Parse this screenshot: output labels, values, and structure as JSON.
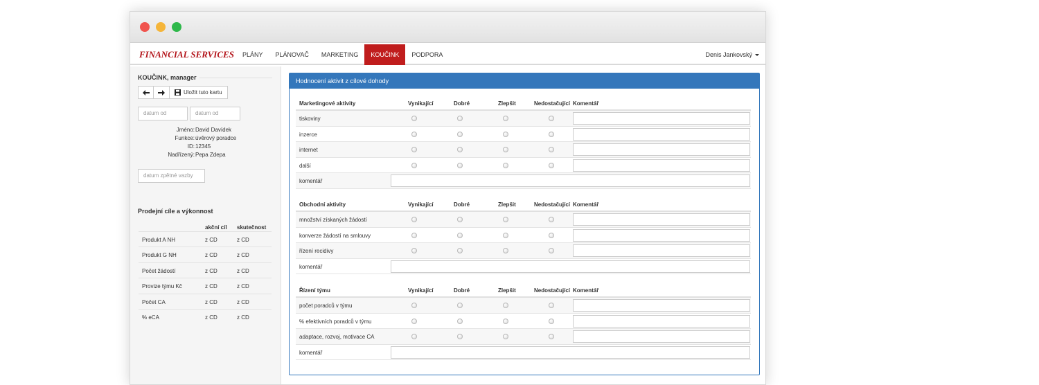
{
  "navbar": {
    "brand": "FINANCIAL SERVICES",
    "items": [
      {
        "label": "PLÁNY"
      },
      {
        "label": "PLÁNOVAČ"
      },
      {
        "label": "MARKETING"
      },
      {
        "label": "KOUČINK",
        "active": true
      },
      {
        "label": "PODPORA"
      }
    ],
    "user": "Denis Jankovský"
  },
  "sidebar": {
    "title": "KOUČINK, manager",
    "toolbar": {
      "back_icon": "arrow-left-icon",
      "forward_icon": "arrow-right-icon",
      "save_label": "Uložit tuto kartu",
      "save_icon": "floppy-disk-icon"
    },
    "date_from_1": "datum od",
    "date_from_2": "datum od",
    "person": {
      "name_label": "Jméno:",
      "name": "David Davídek",
      "function_label": "Funkce:",
      "function": "úvěrový poradce",
      "id_label": "ID:",
      "id": "12345",
      "superior_label": "Nadřízený:",
      "superior": "Pepa Zdepa"
    },
    "feedback_date": "datum zpětné vazby",
    "performance": {
      "title": "Prodejní cíle a výkonnost",
      "headers": [
        "akční cíl",
        "skutečnost"
      ],
      "rows": [
        {
          "name": "Produkt A NH",
          "goal": "z CD",
          "actual": "z CD"
        },
        {
          "name": "Produkt G NH",
          "goal": "z CD",
          "actual": "z CD"
        },
        {
          "name": "Počet žádostí",
          "goal": "z CD",
          "actual": "z CD"
        },
        {
          "name": "Provize týmu Kč",
          "goal": "z CD",
          "actual": "z CD"
        },
        {
          "name": "Počet CA",
          "goal": "z CD",
          "actual": "z CD"
        },
        {
          "name": "% eCA",
          "goal": "z CD",
          "actual": "z CD"
        }
      ]
    }
  },
  "main": {
    "title": "Hodnocení aktivit z cílové dohody",
    "columns": [
      "Vynikající",
      "Dobré",
      "Zlepšit",
      "Nedostačující",
      "Komentář"
    ],
    "groups": [
      {
        "title": "Marketingové aktivity",
        "rows": [
          "tiskoviny",
          "inzerce",
          "internet",
          "další"
        ],
        "comment_label": "komentář"
      },
      {
        "title": "Obchodní aktivity",
        "rows": [
          "množství získaných žádostí",
          "konverze žádostí na smlouvy",
          "řízení recidivy"
        ],
        "comment_label": "komentář"
      },
      {
        "title": "Řízení týmu",
        "rows": [
          "počet poradců v týmu",
          "% efektivních poradců v týmu",
          "adaptace, rozvoj, motivace CA"
        ],
        "comment_label": "komentář"
      }
    ]
  }
}
